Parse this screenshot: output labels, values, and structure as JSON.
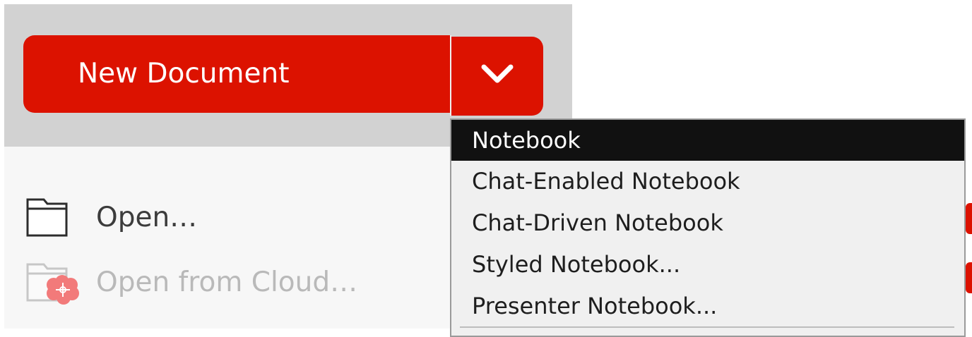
{
  "new_document": {
    "label": "New Document",
    "dropdown_icon": "chevron-down-icon"
  },
  "side_menu": {
    "open": {
      "label": "Open…",
      "icon": "folder-icon",
      "enabled": true
    },
    "open_from_cloud": {
      "label": "Open from Cloud…",
      "icon": "cloud-folder-icon",
      "enabled": false
    }
  },
  "dropdown_menu": {
    "items": [
      {
        "label": "Notebook",
        "selected": true
      },
      {
        "label": "Chat-Enabled Notebook",
        "selected": false
      },
      {
        "label": "Chat-Driven Notebook",
        "selected": false
      },
      {
        "label": "Styled Notebook...",
        "selected": false
      },
      {
        "label": "Presenter Notebook...",
        "selected": false
      }
    ]
  },
  "colors": {
    "accent": "#dc1200",
    "panel_top": "#d2d2d2",
    "panel_bottom": "#f7f7f7",
    "menu_background": "#f0f0f0",
    "menu_selected": "#111111",
    "disabled_text": "#b9b9b9"
  }
}
